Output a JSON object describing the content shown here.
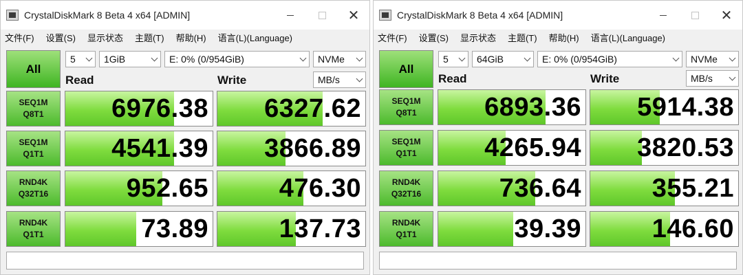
{
  "windows": [
    {
      "title": "CrystalDiskMark 8 Beta 4 x64 [ADMIN]",
      "menu": [
        "文件(F)",
        "设置(S)",
        "显示状态",
        "主题(T)",
        "帮助(H)",
        "语言(L)(Language)"
      ],
      "all_button": "All",
      "count": "5",
      "size": "1GiB",
      "drive": "E: 0% (0/954GiB)",
      "mode": "NVMe",
      "unit": "MB/s",
      "read_header": "Read",
      "write_header": "Write",
      "tests": [
        {
          "line1": "SEQ1M",
          "line2": "Q8T1",
          "read": "6976.38",
          "write": "6327.62",
          "read_fill": 0.74,
          "write_fill": 0.71
        },
        {
          "line1": "SEQ1M",
          "line2": "Q1T1",
          "read": "4541.39",
          "write": "3866.89",
          "read_fill": 0.74,
          "write_fill": 0.46
        },
        {
          "line1": "RND4K",
          "line2": "Q32T16",
          "read": "952.65",
          "write": "476.30",
          "read_fill": 0.66,
          "write_fill": 0.58
        },
        {
          "line1": "RND4K",
          "line2": "Q1T1",
          "read": "73.89",
          "write": "137.73",
          "read_fill": 0.48,
          "write_fill": 0.53
        }
      ],
      "status": ""
    },
    {
      "title": "CrystalDiskMark 8 Beta 4 x64 [ADMIN]",
      "menu": [
        "文件(F)",
        "设置(S)",
        "显示状态",
        "主题(T)",
        "帮助(H)",
        "语言(L)(Language)"
      ],
      "all_button": "All",
      "count": "5",
      "size": "64GiB",
      "drive": "E: 0% (0/954GiB)",
      "mode": "NVMe",
      "unit": "MB/s",
      "read_header": "Read",
      "write_header": "Write",
      "tests": [
        {
          "line1": "SEQ1M",
          "line2": "Q8T1",
          "read": "6893.36",
          "write": "5914.38",
          "read_fill": 0.73,
          "write_fill": 0.47
        },
        {
          "line1": "SEQ1M",
          "line2": "Q1T1",
          "read": "4265.94",
          "write": "3820.53",
          "read_fill": 0.46,
          "write_fill": 0.35
        },
        {
          "line1": "RND4K",
          "line2": "Q32T16",
          "read": "736.64",
          "write": "355.21",
          "read_fill": 0.66,
          "write_fill": 0.57
        },
        {
          "line1": "RND4K",
          "line2": "Q1T1",
          "read": "39.39",
          "write": "146.60",
          "read_fill": 0.51,
          "write_fill": 0.54
        }
      ],
      "status": ""
    }
  ],
  "colors": {
    "accent_green": "#5fc72a",
    "label_green": "#4cba2c"
  }
}
